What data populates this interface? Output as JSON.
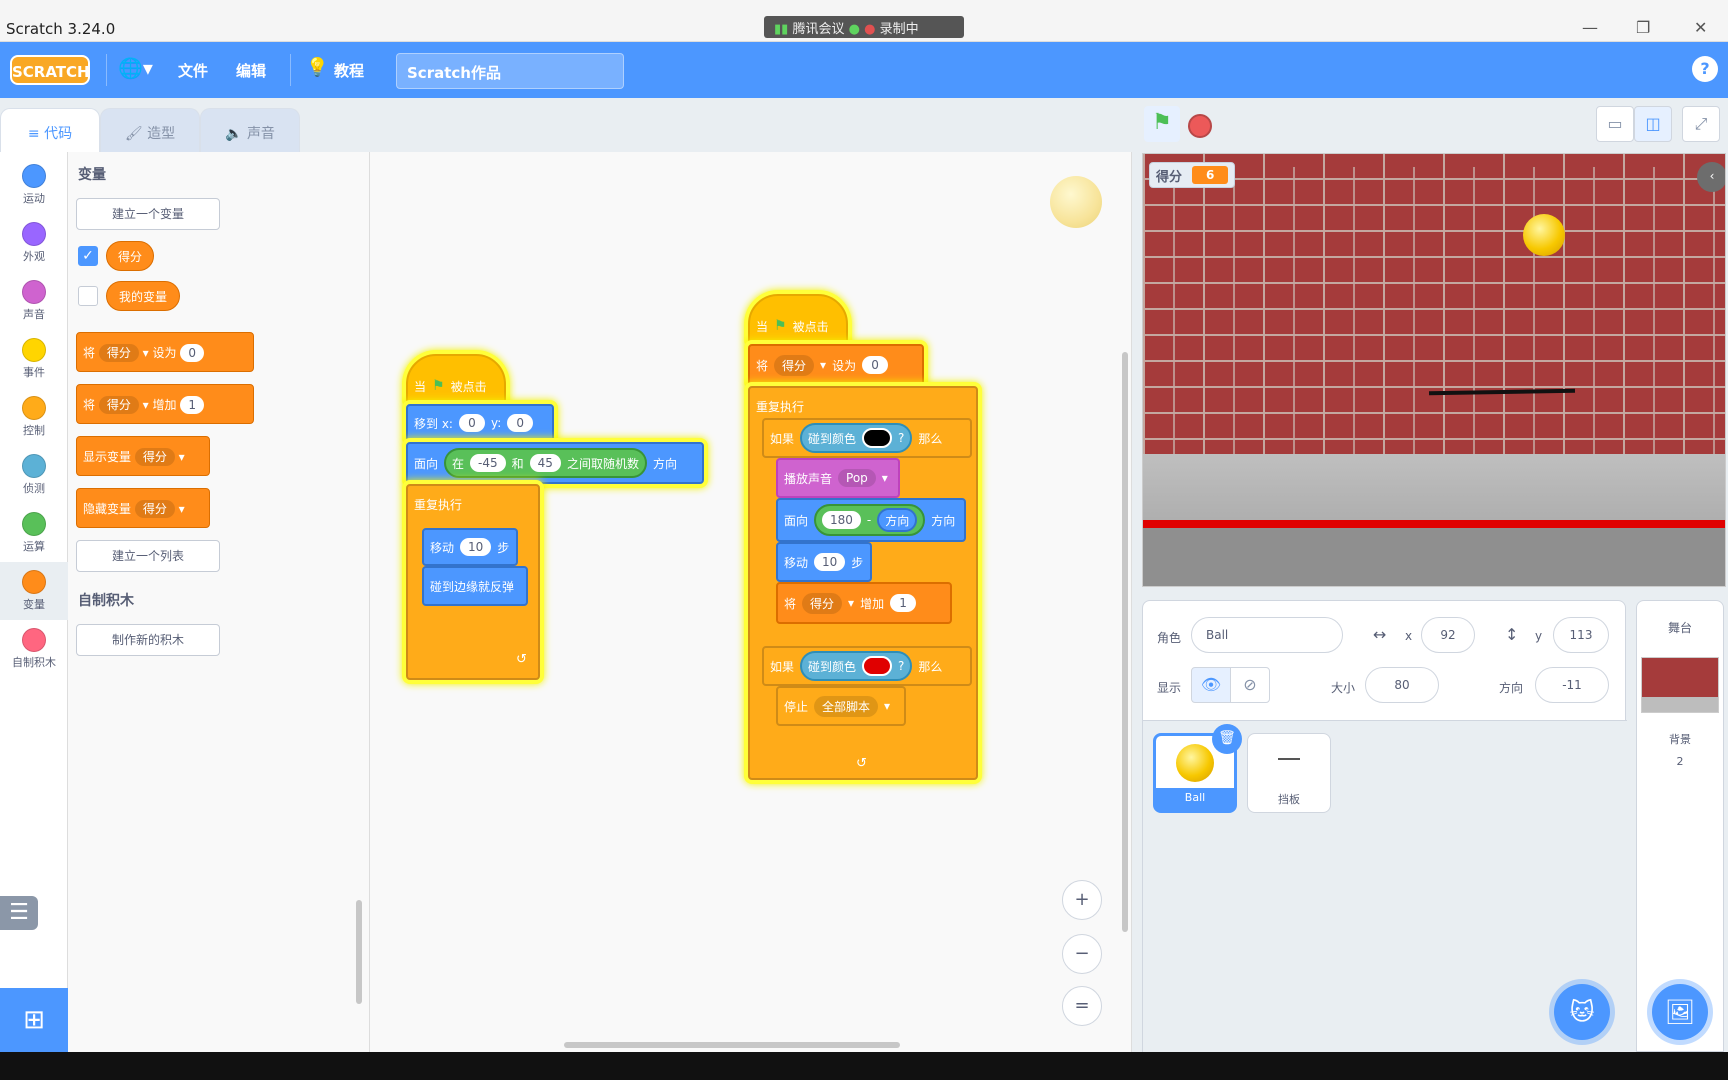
{
  "window": {
    "title": "Scratch 3.24.0",
    "meeting": "腾讯会议",
    "recording": "录制中"
  },
  "menu": {
    "logo": "SCRATCH",
    "file": "文件",
    "edit": "编辑",
    "tutorials": "教程",
    "project_title": "Scratch作品"
  },
  "tabs": [
    {
      "label": "代码"
    },
    {
      "label": "造型"
    },
    {
      "label": "声音"
    }
  ],
  "categories": [
    {
      "label": "运动",
      "color": "#4c97ff"
    },
    {
      "label": "外观",
      "color": "#9966ff"
    },
    {
      "label": "声音",
      "color": "#cf63cf"
    },
    {
      "label": "事件",
      "color": "#ffd500"
    },
    {
      "label": "控制",
      "color": "#ffab19"
    },
    {
      "label": "侦测",
      "color": "#5cb1d6"
    },
    {
      "label": "运算",
      "color": "#59c059"
    },
    {
      "label": "变量",
      "color": "#ff8c1a"
    },
    {
      "label": "自制积木",
      "color": "#ff6680"
    }
  ],
  "palette": {
    "variables_heading": "变量",
    "make_variable": "建立一个变量",
    "var_score": "得分",
    "var_my": "我的变量",
    "set_block": {
      "prefix": "将",
      "var": "得分",
      "op": "设为",
      "value": "0"
    },
    "change_block": {
      "prefix": "将",
      "var": "得分",
      "op": "增加",
      "value": "1"
    },
    "show_block": {
      "label": "显示变量",
      "var": "得分"
    },
    "hide_block": {
      "label": "隐藏变量",
      "var": "得分"
    },
    "make_list": "建立一个列表",
    "my_blocks_heading": "自制积木",
    "make_block": "制作新的积木"
  },
  "script1": {
    "hat": {
      "when": "当",
      "clicked": "被点击"
    },
    "goto": {
      "label": "移到 x:",
      "x": "0",
      "ylabel": "y:",
      "y": "0"
    },
    "point": {
      "label": "面向",
      "in": "在",
      "a": "-45",
      "and": "和",
      "b": "45",
      "between": "之间取随机数",
      "dir": "方向"
    },
    "forever": "重复执行",
    "move": {
      "label": "移动",
      "steps": "10",
      "unit": "步"
    },
    "bounce": "碰到边缘就反弹"
  },
  "script2": {
    "hat": {
      "when": "当",
      "clicked": "被点击"
    },
    "set": {
      "prefix": "将",
      "var": "得分",
      "op": "设为",
      "value": "0"
    },
    "forever": "重复执行",
    "if1": {
      "if": "如果",
      "touching": "碰到颜色",
      "q": "?",
      "then": "那么",
      "color": "#000000"
    },
    "play": {
      "label": "播放声音",
      "sound": "Pop"
    },
    "point": {
      "label": "面向",
      "a": "180",
      "minus": "-",
      "dir_rep": "方向",
      "dir": "方向"
    },
    "move": {
      "label": "移动",
      "steps": "10",
      "unit": "步"
    },
    "change": {
      "prefix": "将",
      "var": "得分",
      "op": "增加",
      "value": "1"
    },
    "if2": {
      "if": "如果",
      "touching": "碰到颜色",
      "q": "?",
      "then": "那么",
      "color": "#e00000"
    },
    "stop": {
      "label": "停止",
      "option": "全部脚本"
    }
  },
  "zoom": {
    "in": "+",
    "out": "−",
    "reset": "="
  },
  "stage": {
    "monitor_label": "得分",
    "monitor_value": "6"
  },
  "sprite_info": {
    "sprite_label": "角色",
    "sprite_name": "Ball",
    "x_label": "x",
    "x": "92",
    "y_label": "y",
    "y": "113",
    "show_label": "显示",
    "size_label": "大小",
    "size": "80",
    "dir_label": "方向",
    "direction": "-11"
  },
  "sprites": [
    {
      "name": "Ball"
    },
    {
      "name": "挡板"
    }
  ],
  "backdrop": {
    "heading": "舞台",
    "label": "背景",
    "count": "2"
  }
}
